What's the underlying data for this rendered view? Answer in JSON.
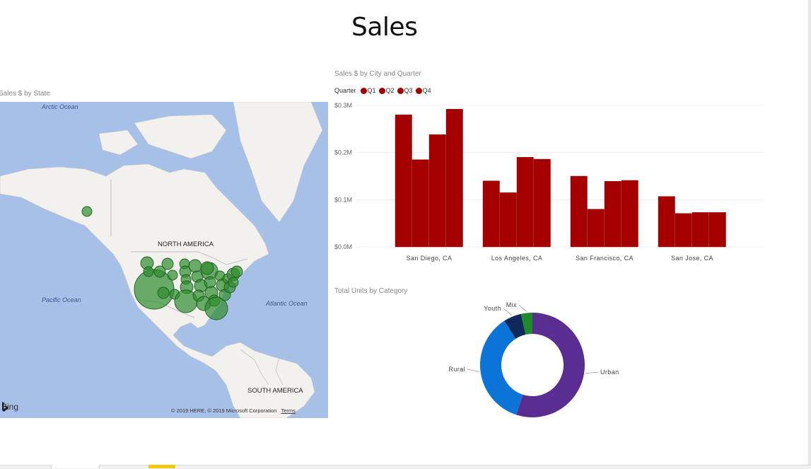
{
  "page": {
    "title": "Sales"
  },
  "map_visual": {
    "title": "Sales $ by State",
    "oceans": {
      "arctic": "Arctic Ocean",
      "pacific": "Pacific Ocean",
      "atlantic": "Atlantic Ocean"
    },
    "continents": {
      "north": "NORTH AMERICA",
      "south": "SOUTH AMERICA"
    },
    "bing_label": "Bing",
    "copyright": "© 2019 HERE, © 2019 Microsoft Corporation",
    "terms_label": "Terms",
    "bubble_color": "#2e8b2e"
  },
  "bar_visual": {
    "title": "Sales $ by City and Quarter",
    "legend_title": "Quarter",
    "legend": [
      "Q1",
      "Q2",
      "Q3",
      "Q4"
    ],
    "bar_color": "#a50000"
  },
  "donut_visual": {
    "title": "Total Units by Category"
  },
  "chart_data": [
    {
      "type": "bar",
      "title": "Sales $ by City and Quarter",
      "categories": [
        "San Diego, CA",
        "Los Angeles, CA",
        "San Francisco, CA",
        "San Jose, CA"
      ],
      "series": [
        {
          "name": "Q1",
          "values": [
            0.28,
            0.14,
            0.15,
            0.107
          ]
        },
        {
          "name": "Q2",
          "values": [
            0.185,
            0.115,
            0.08,
            0.071
          ]
        },
        {
          "name": "Q3",
          "values": [
            0.238,
            0.19,
            0.139,
            0.073
          ]
        },
        {
          "name": "Q4",
          "values": [
            0.292,
            0.186,
            0.141,
            0.073
          ]
        }
      ],
      "yticks": [
        "$0.0M",
        "$0.1M",
        "$0.2M",
        "$0.3M"
      ],
      "ylim": [
        0,
        0.3
      ],
      "grid": true,
      "legend_position": "top-left"
    },
    {
      "type": "pie",
      "title": "Total Units by Category",
      "categories": [
        "Urban",
        "Rural",
        "Youth",
        "Mix"
      ],
      "values": [
        55,
        36,
        5.5,
        3.5
      ],
      "colors": [
        "#5a2d91",
        "#0b74d6",
        "#0f2a5a",
        "#1e8a2a"
      ],
      "donut": true
    }
  ]
}
